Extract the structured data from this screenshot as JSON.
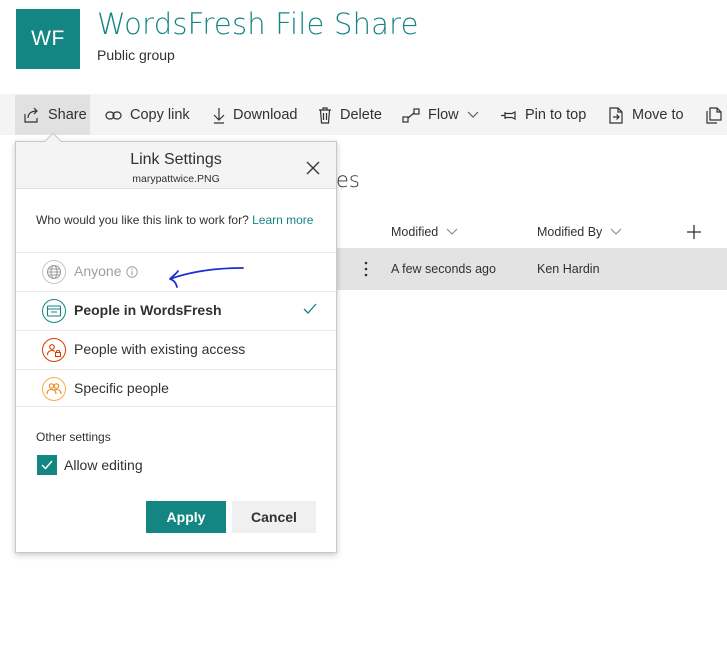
{
  "site": {
    "logo_initials": "WF",
    "title": "WordsFresh File Share",
    "subtitle": "Public group"
  },
  "toolbar": {
    "share": "Share",
    "copy_link": "Copy link",
    "download": "Download",
    "delete": "Delete",
    "flow": "Flow",
    "pin_to_top": "Pin to top",
    "move_to": "Move to"
  },
  "library": {
    "title_partial": "es",
    "columns": {
      "modified": "Modified",
      "modified_by": "Modified By"
    },
    "row": {
      "modified": "A few seconds ago",
      "modified_by": "Ken Hardin"
    }
  },
  "dialog": {
    "title": "Link Settings",
    "filename": "marypattwice.PNG",
    "question": "Who would you like this link to work for?",
    "learn_more": "Learn more",
    "options": [
      {
        "label": "Anyone",
        "enabled": false,
        "selected": false,
        "icon": "globe-icon"
      },
      {
        "label": "People in WordsFresh",
        "enabled": true,
        "selected": true,
        "icon": "building-icon"
      },
      {
        "label": "People with existing access",
        "enabled": true,
        "selected": false,
        "icon": "people-lock-icon"
      },
      {
        "label": "Specific people",
        "enabled": true,
        "selected": false,
        "icon": "people-icon"
      }
    ],
    "other_settings": "Other settings",
    "allow_editing": "Allow editing",
    "allow_editing_checked": true,
    "apply": "Apply",
    "cancel": "Cancel"
  },
  "colors": {
    "brand": "#138582",
    "toolbar_bg": "#f4f4f4",
    "disabled_text": "#a19f9d",
    "option_red": "#d83b01",
    "option_orange": "#ffaa44",
    "annotation": "#1a2fd0"
  }
}
